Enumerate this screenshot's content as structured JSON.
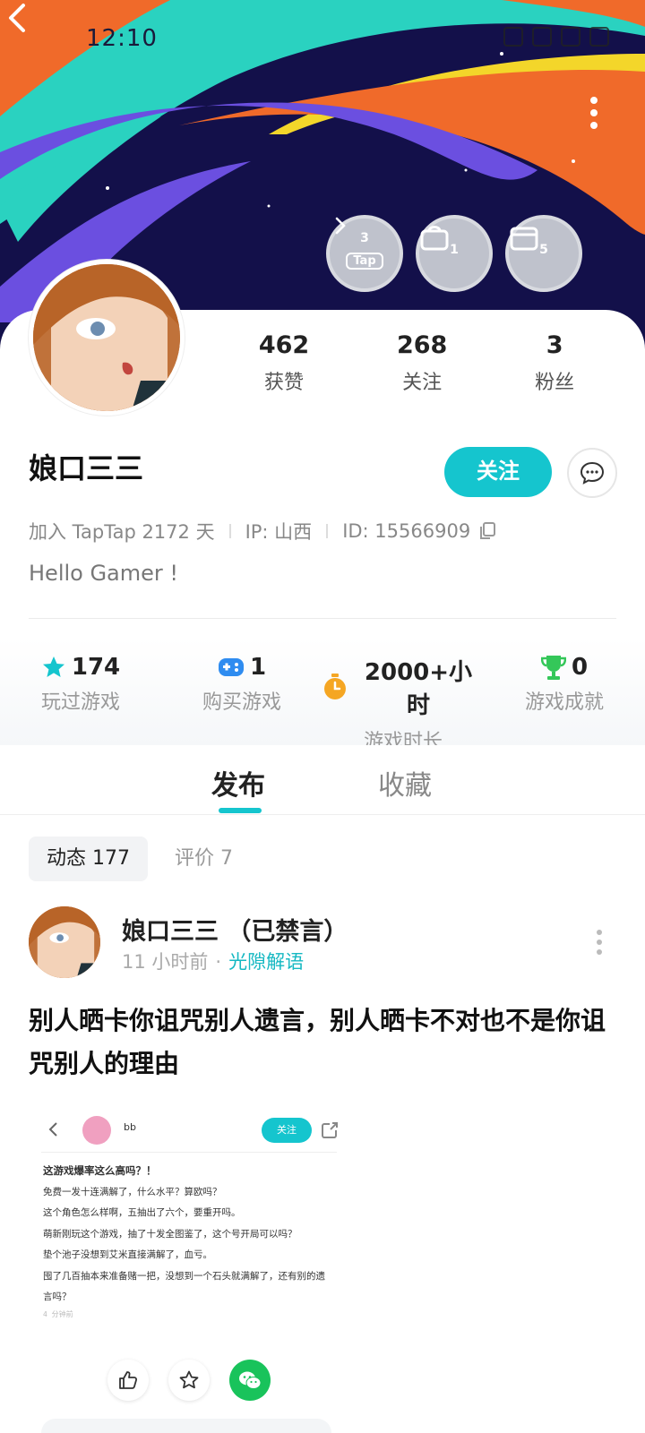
{
  "status_bar": {
    "time": "12:10"
  },
  "header": {
    "badges": [
      {
        "count": "3",
        "label": "Tap"
      },
      {
        "count": "1",
        "label": ""
      },
      {
        "count": "5",
        "label": ""
      }
    ]
  },
  "profile": {
    "stats": [
      {
        "value": "462",
        "label": "获赞"
      },
      {
        "value": "268",
        "label": "关注"
      },
      {
        "value": "3",
        "label": "粉丝"
      }
    ],
    "username": "娘口三三",
    "follow_label": "关注",
    "joined": "加入 TapTap 2172 天",
    "ip": "IP: 山西",
    "id": "ID: 15566909",
    "bio": "Hello Gamer !"
  },
  "game_stats": [
    {
      "value": "174",
      "label": "玩过游戏",
      "icon": "star-icon",
      "color": "#15c5ce"
    },
    {
      "value": "1",
      "label": "购买游戏",
      "icon": "gamepad-icon",
      "color": "#2f8cf0"
    },
    {
      "value": "2000+小时",
      "label": "游戏时长",
      "icon": "timer-icon",
      "color": "#f5a623"
    },
    {
      "value": "0",
      "label": "游戏成就",
      "icon": "trophy-icon",
      "color": "#34c759"
    }
  ],
  "tabs": {
    "active": "发布",
    "inactive": "收藏"
  },
  "subtabs": {
    "active": "动态 177",
    "inactive": "评价 7"
  },
  "post": {
    "author": "娘口三三 （已禁言）",
    "time": "11 小时前",
    "dot": "·",
    "category": "光隙解语",
    "title": "别人晒卡你诅咒别人遗言，别人晒卡不对也不是你诅咒别人的理由",
    "embed": {
      "name": "bb",
      "follow": "关注",
      "heading": "这游戏爆率这么高吗？！",
      "lines": [
        "免费一发十连满解了，什么水平？算欧吗？",
        "这个角色怎么样啊，五抽出了六个，要重开吗。",
        "萌新刚玩这个游戏，抽了十发全图鉴了，这个号开局可以吗？",
        "垫个池子没想到艾米直接满解了，血亏。",
        "囤了几百抽本来准备赌一把，没想到一个石头就满解了，还有别的遗言吗？"
      ],
      "time": "4 分钟前"
    }
  },
  "colors": {
    "accent": "#15c5ce",
    "wechat": "#19c35b"
  }
}
